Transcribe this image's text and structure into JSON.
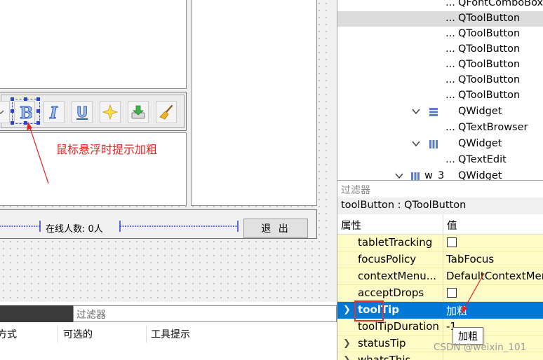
{
  "object_tree": {
    "rows": [
      {
        "dots": "...",
        "label": "QFontComboBox"
      },
      {
        "dots": "...",
        "label": "QToolButton"
      },
      {
        "dots": "...",
        "label": "QToolButton"
      },
      {
        "dots": "...",
        "label": "QToolButton"
      },
      {
        "dots": "...",
        "label": "QToolButton"
      },
      {
        "dots": "...",
        "label": "QToolButton"
      },
      {
        "dots": "...",
        "label": "QToolButton"
      },
      {
        "label": "QWidget"
      },
      {
        "dots": "...",
        "label": "QTextBrowser"
      },
      {
        "label": "QWidget"
      },
      {
        "dots": "...",
        "label": "QTextEdit"
      },
      {
        "name": "w_3",
        "label": "QWidget"
      }
    ]
  },
  "canvas": {
    "annotation": "鼠标悬浮时提示加粗",
    "online_label": "在线人数: 0人",
    "quit_button": "退 出"
  },
  "property_editor": {
    "filter_placeholder": "过滤器",
    "object_title": "toolButton : QToolButton",
    "col_property": "属性",
    "col_value": "值",
    "rows": [
      {
        "name": "tabletTracking",
        "value": ""
      },
      {
        "name": "focusPolicy",
        "value": "TabFocus"
      },
      {
        "name": "contextMenu...",
        "value": "DefaultContextMen"
      },
      {
        "name": "acceptDrops",
        "value": ""
      },
      {
        "name": "toolTip",
        "value": "加粗"
      },
      {
        "name": "toolTipDuration",
        "value": "-1"
      },
      {
        "name": "statusTip",
        "value": ""
      },
      {
        "name": "whatsThis",
        "value": ""
      }
    ],
    "tooltip_popup": "加粗"
  },
  "widget_box": {
    "filter_placeholder": "过滤器",
    "col_1": "方式",
    "col_2": "可选的",
    "col_3": "工具提示"
  },
  "watermark": "CSDN @weixin_101",
  "colors": {
    "selection": "#0078d7",
    "property_row": "#fffbc6",
    "annotation_red": "#e82020"
  }
}
